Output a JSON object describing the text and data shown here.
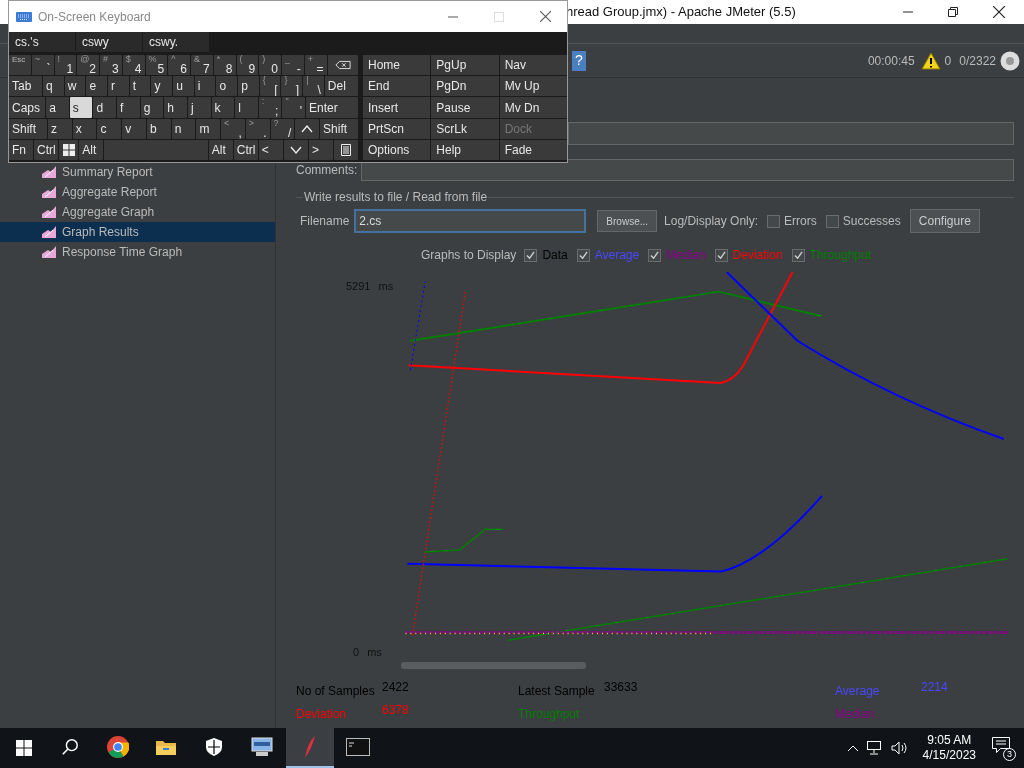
{
  "jmeter": {
    "title": "hread Group.jmx) - Apache JMeter (5.5)",
    "toolbar": {
      "help": "?",
      "elapsed": "00:00:45",
      "warnings": "0",
      "threads": "0/2322"
    },
    "tree": [
      {
        "label": "Summary Report",
        "selected": false
      },
      {
        "label": "Aggregate Report",
        "selected": false
      },
      {
        "label": "Aggregate Graph",
        "selected": false
      },
      {
        "label": "Graph Results",
        "selected": true
      },
      {
        "label": "Response Time Graph",
        "selected": false
      }
    ],
    "form": {
      "comments_label": "Comments:",
      "group_title": "Write results to file / Read from file",
      "filename_label": "Filename",
      "filename_value": "2.cs",
      "browse": "Browse...",
      "log_label": "Log/Display Only:",
      "options": [
        {
          "label": "Errors",
          "checked": false
        },
        {
          "label": "Successes",
          "checked": false
        }
      ],
      "configure": "Configure"
    },
    "graphs_label": "Graphs to Display",
    "legend": [
      {
        "label": "Data",
        "checked": true,
        "color": "#000000"
      },
      {
        "label": "Average",
        "checked": true,
        "color": "#4848ff"
      },
      {
        "label": "Median",
        "checked": true,
        "color": "#8b008b"
      },
      {
        "label": "Deviation",
        "checked": true,
        "color": "#ff0000"
      },
      {
        "label": "Throughput",
        "checked": true,
        "color": "#008000"
      }
    ],
    "graph": {
      "y_max": "5291",
      "y_max_unit": "ms",
      "y_min": "0",
      "y_min_unit": "ms"
    },
    "stats": [
      {
        "label": "No of Samples",
        "value": "2422",
        "color": "#000000"
      },
      {
        "label": "Latest Sample",
        "value": "33633",
        "color": "#000000"
      },
      {
        "label": "Average",
        "value": "2214",
        "color": "#4848ff"
      },
      {
        "label": "Deviation",
        "value": "6378",
        "color": "#ff0000"
      },
      {
        "label": "Throughput",
        "color": "#008000"
      },
      {
        "label": "Median",
        "color": "#8b008b"
      }
    ]
  },
  "keyboard": {
    "title": "On-Screen Keyboard",
    "predictions": [
      "cs.'s",
      "cswy",
      "cswy."
    ],
    "rows": [
      {
        "keys": [
          {
            "kind": "char",
            "alt": "Esc",
            "selected": false
          },
          {
            "kind": "char",
            "alt": "~",
            "main": "`",
            "selected": false
          },
          {
            "kind": "char",
            "alt": "!",
            "main": "1",
            "selected": false
          },
          {
            "kind": "char",
            "alt": "@",
            "main": "2",
            "selected": false
          },
          {
            "kind": "char",
            "alt": "#",
            "main": "3",
            "selected": false
          },
          {
            "kind": "char",
            "alt": "$",
            "main": "4",
            "selected": false
          },
          {
            "kind": "char",
            "alt": "%",
            "main": "5",
            "selected": false
          },
          {
            "kind": "char",
            "alt": "^",
            "main": "6",
            "selected": false
          },
          {
            "kind": "char",
            "alt": "&",
            "main": "7",
            "selected": false
          },
          {
            "kind": "char",
            "alt": "*",
            "main": "8",
            "selected": false
          },
          {
            "kind": "char",
            "alt": "(",
            "main": "9",
            "selected": false
          },
          {
            "kind": "char",
            "alt": ")",
            "main": "0",
            "selected": false
          },
          {
            "kind": "char",
            "alt": "_",
            "main": "-",
            "selected": false
          },
          {
            "kind": "char",
            "alt": "+",
            "main": "=",
            "selected": false
          },
          {
            "kind": "backspace",
            "selected": false
          }
        ]
      },
      {
        "keys": [
          {
            "kind": "wide",
            "main": "Tab",
            "selected": false
          },
          {
            "kind": "char",
            "main": "q",
            "selected": false
          },
          {
            "kind": "char",
            "main": "w",
            "selected": false
          },
          {
            "kind": "char",
            "main": "e",
            "selected": false
          },
          {
            "kind": "char",
            "main": "r",
            "selected": false
          },
          {
            "kind": "char",
            "main": "t",
            "selected": false
          },
          {
            "kind": "char",
            "main": "y",
            "selected": false
          },
          {
            "kind": "char",
            "main": "u",
            "selected": false
          },
          {
            "kind": "char",
            "main": "i",
            "selected": false
          },
          {
            "kind": "char",
            "main": "o",
            "selected": false
          },
          {
            "kind": "char",
            "main": "p",
            "selected": false
          },
          {
            "kind": "char",
            "alt": "{",
            "main": "[",
            "selected": false
          },
          {
            "kind": "char",
            "alt": "}",
            "main": "]",
            "selected": false
          },
          {
            "kind": "char",
            "alt": "|",
            "main": "\\",
            "selected": false
          },
          {
            "kind": "wide",
            "main": "Del",
            "selected": false
          }
        ]
      },
      {
        "keys": [
          {
            "kind": "wide",
            "main": "Caps",
            "selected": false
          },
          {
            "kind": "char",
            "main": "a",
            "selected": false
          },
          {
            "kind": "char",
            "main": "s",
            "selected": true
          },
          {
            "kind": "char",
            "main": "d",
            "selected": false
          },
          {
            "kind": "char",
            "main": "f",
            "selected": false
          },
          {
            "kind": "char",
            "main": "g",
            "selected": false
          },
          {
            "kind": "char",
            "main": "h",
            "selected": false
          },
          {
            "kind": "char",
            "main": "j",
            "selected": false
          },
          {
            "kind": "char",
            "main": "k",
            "selected": false
          },
          {
            "kind": "char",
            "main": "l",
            "selected": false
          },
          {
            "kind": "char",
            "alt": ":",
            "main": ";",
            "selected": false
          },
          {
            "kind": "char",
            "alt": "\"",
            "main": "'",
            "selected": false
          },
          {
            "kind": "enter",
            "main": "Enter",
            "selected": false
          }
        ]
      },
      {
        "keys": [
          {
            "kind": "wide",
            "main": "Shift",
            "selected": false
          },
          {
            "kind": "char",
            "main": "z",
            "selected": false
          },
          {
            "kind": "char",
            "main": "x",
            "selected": false
          },
          {
            "kind": "char",
            "main": "c",
            "selected": false
          },
          {
            "kind": "char",
            "main": "v",
            "selected": false
          },
          {
            "kind": "char",
            "main": "b",
            "selected": false
          },
          {
            "kind": "char",
            "main": "n",
            "selected": false
          },
          {
            "kind": "char",
            "main": "m",
            "selected": false
          },
          {
            "kind": "char",
            "alt": "<",
            "main": ",",
            "selected": false
          },
          {
            "kind": "char",
            "alt": ">",
            "main": ".",
            "selected": false
          },
          {
            "kind": "char",
            "alt": "?",
            "main": "/",
            "selected": false
          },
          {
            "kind": "up",
            "selected": false
          },
          {
            "kind": "wide",
            "main": "Shift",
            "selected": false
          }
        ]
      },
      {
        "keys": [
          {
            "kind": "char",
            "main": "Fn",
            "selected": false
          },
          {
            "kind": "char",
            "main": "Ctrl",
            "selected": false
          },
          {
            "kind": "windows",
            "selected": false
          },
          {
            "kind": "char",
            "main": "Alt",
            "selected": false
          },
          {
            "kind": "space",
            "selected": false
          },
          {
            "kind": "char",
            "main": "Alt",
            "selected": false
          },
          {
            "kind": "char",
            "main": "Ctrl",
            "selected": false
          },
          {
            "kind": "char",
            "main": "<",
            "selected": false
          },
          {
            "kind": "down",
            "selected": false
          },
          {
            "kind": "char",
            "main": ">",
            "selected": false
          },
          {
            "kind": "menu",
            "selected": false
          }
        ]
      }
    ],
    "nav": [
      [
        {
          "label": "Home",
          "disabled": false
        },
        {
          "label": "PgUp",
          "disabled": false
        },
        {
          "label": "Nav",
          "disabled": false
        }
      ],
      [
        {
          "label": "End",
          "disabled": false
        },
        {
          "label": "PgDn",
          "disabled": false
        },
        {
          "label": "Mv Up",
          "disabled": false
        }
      ],
      [
        {
          "label": "Insert",
          "disabled": false
        },
        {
          "label": "Pause",
          "disabled": false
        },
        {
          "label": "Mv Dn",
          "disabled": false
        }
      ],
      [
        {
          "label": "PrtScn",
          "disabled": false
        },
        {
          "label": "ScrLk",
          "disabled": false
        },
        {
          "label": "Dock",
          "disabled": true
        }
      ],
      [
        {
          "label": "Options",
          "disabled": false
        },
        {
          "label": "Help",
          "disabled": false
        },
        {
          "label": "Fade",
          "disabled": false
        }
      ]
    ]
  },
  "taskbar": {
    "apps": [
      {
        "kind": "search",
        "selected": false
      },
      {
        "kind": "browser",
        "selected": false
      },
      {
        "kind": "folder",
        "selected": false
      },
      {
        "kind": "shield",
        "selected": false
      },
      {
        "kind": "monitor",
        "selected": false
      },
      {
        "kind": "feather",
        "selected": true
      },
      {
        "kind": "terminal",
        "selected": false
      }
    ],
    "time": "9:05 AM",
    "date": "4/15/2023",
    "notifications": "3"
  }
}
